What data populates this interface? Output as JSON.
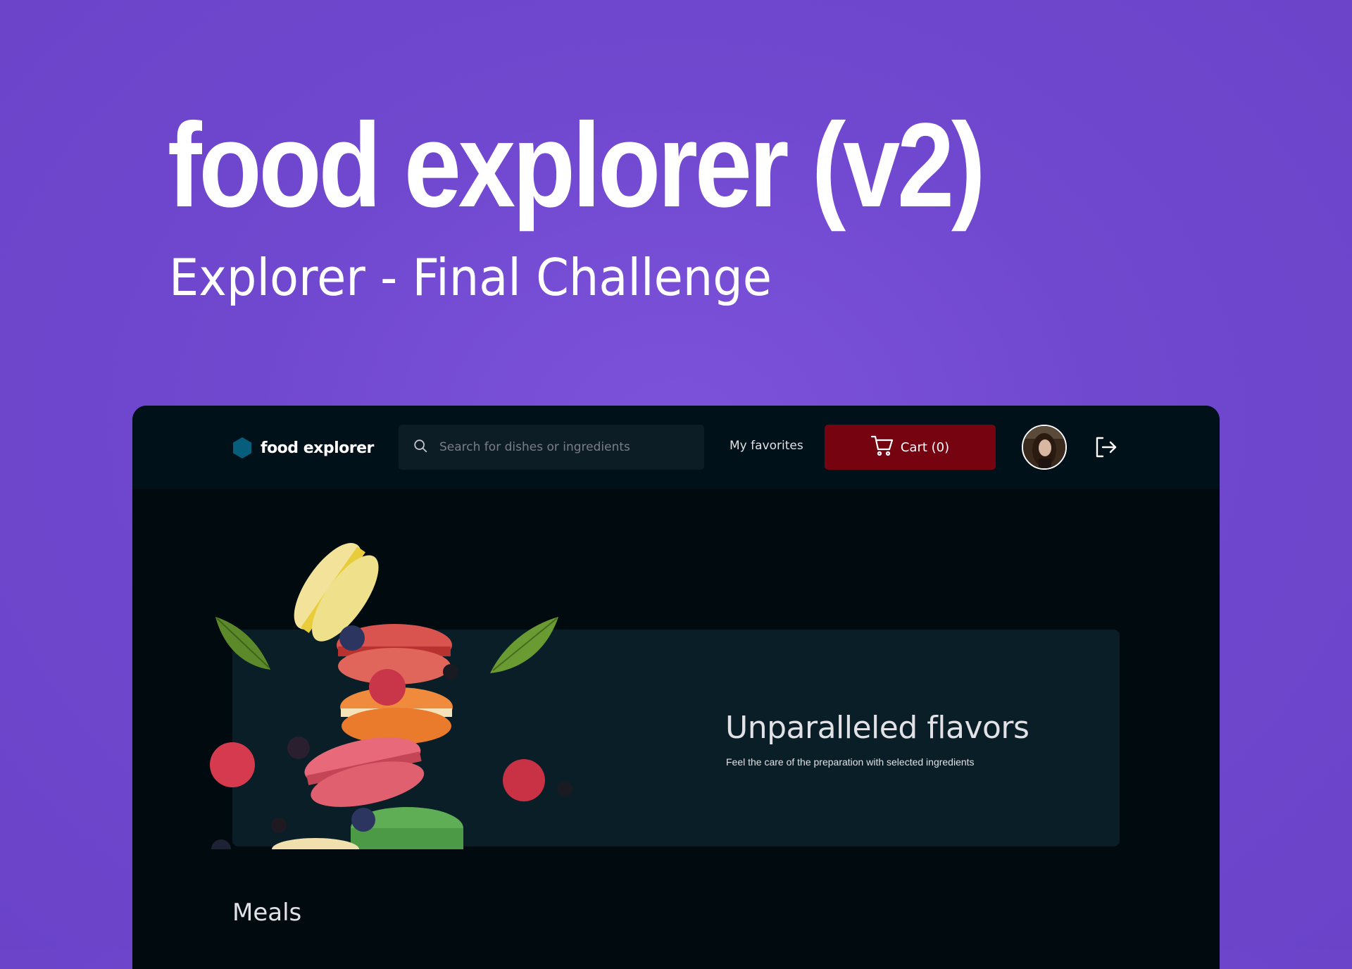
{
  "cover": {
    "title": "food explorer (v2)",
    "subtitle": "Explorer - Final Challenge"
  },
  "header": {
    "brand": "food explorer",
    "search": {
      "placeholder": "Search for dishes or ingredients",
      "value": ""
    },
    "favorites_label": "My favorites",
    "cart_label": "Cart (0)",
    "icons": [
      "hexagon-logo-icon",
      "search-icon",
      "cart-icon",
      "user-avatar",
      "sign-out-icon"
    ]
  },
  "banner": {
    "title": "Unparalleled flavors",
    "text": "Feel the care of the preparation with selected ingredients"
  },
  "sections": [
    {
      "title": "Meals"
    }
  ],
  "colors": {
    "background": "#7048cf",
    "app_background": "#000a0f",
    "header_background": "#00111a",
    "banner_background": "#091e26",
    "cart_button": "#750310",
    "brand_accent": "#065e7c",
    "text_light": "#e1e1e6"
  }
}
